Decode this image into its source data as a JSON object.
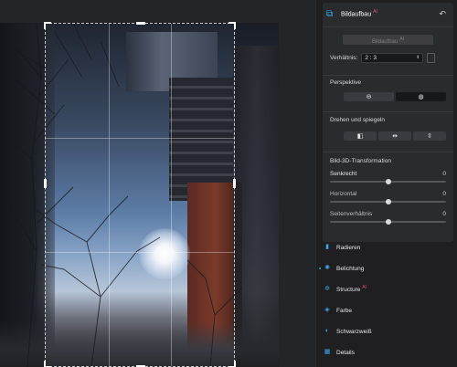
{
  "canvas": {
    "photo_alt": "Winter-Baumkronen mit Sonne und Gebäuden"
  },
  "panel": {
    "header": {
      "title": "Bildaufbau",
      "ai_mark": "AI",
      "crop_icon": "crop-icon",
      "undo_icon": "undo-icon"
    },
    "ai_button": {
      "label": "Bildaufbau",
      "mark": "AI"
    },
    "ratio": {
      "label": "Verhältnis:",
      "value": "2 : 3"
    },
    "perspective": {
      "title": "Perspektive",
      "buttons": [
        "perspective-auto-icon",
        "perspective-level-icon"
      ]
    },
    "rotate": {
      "title": "Drehen und spiegeln",
      "buttons": [
        "rotate-icon",
        "flip-horizontal-icon",
        "flip-vertical-icon"
      ]
    },
    "transform": {
      "title": "Bild-3D-Transformation",
      "sliders": [
        {
          "label": "Senkrecht",
          "value": "0",
          "level": 0.5
        },
        {
          "label": "Horizontal",
          "value": "0",
          "level": 0.5
        },
        {
          "label": "Seitenverhältnis",
          "value": "0",
          "level": 0.5
        }
      ]
    },
    "modules": [
      {
        "label": "Radieren",
        "icon": "eraser-icon",
        "ai": ""
      },
      {
        "label": "Belichtung",
        "icon": "sun-icon",
        "ai": ""
      },
      {
        "label": "Structure",
        "icon": "structure-icon",
        "ai": "AI"
      },
      {
        "label": "Farbe",
        "icon": "color-icon",
        "ai": ""
      },
      {
        "label": "Schwarzweiß",
        "icon": "bw-icon",
        "ai": ""
      },
      {
        "label": "Details",
        "icon": "details-icon",
        "ai": ""
      }
    ],
    "accent_color": "#38a8e8",
    "ai_color": "#e44b6c"
  }
}
